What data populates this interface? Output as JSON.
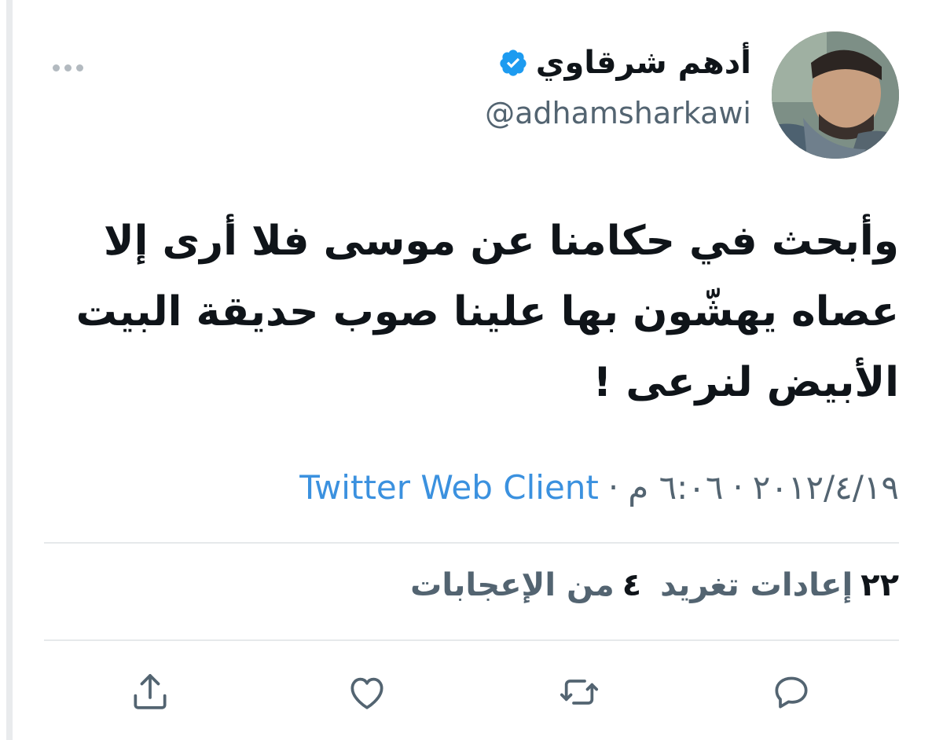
{
  "user": {
    "display_name": "أدهم شرقاوي",
    "handle": "@adhamsharkawi",
    "verified": true
  },
  "tweet": {
    "text": "وأبحث في حكامنا عن موسى فلا أرى إلا عصاه يهشّون بها علينا صوب حديقة البيت الأبيض لنرعى !",
    "date": "٢٠١٢/٤/١٩",
    "time": "٦:٠٦ م",
    "source": "Twitter Web Client",
    "separator": "·"
  },
  "stats": {
    "retweets_count": "٢٢",
    "retweets_label": "إعادات تغريد",
    "likes_count": "٤",
    "likes_label": "من الإعجابات"
  },
  "icons": {
    "verified": "verified-badge-icon",
    "more": "more-options-icon",
    "reply": "reply-icon",
    "retweet": "retweet-icon",
    "like": "heart-icon",
    "share": "share-icon"
  },
  "colors": {
    "link": "#3b91df",
    "muted": "#536471",
    "verified": "#1d9bf0",
    "icon": "#536471"
  }
}
